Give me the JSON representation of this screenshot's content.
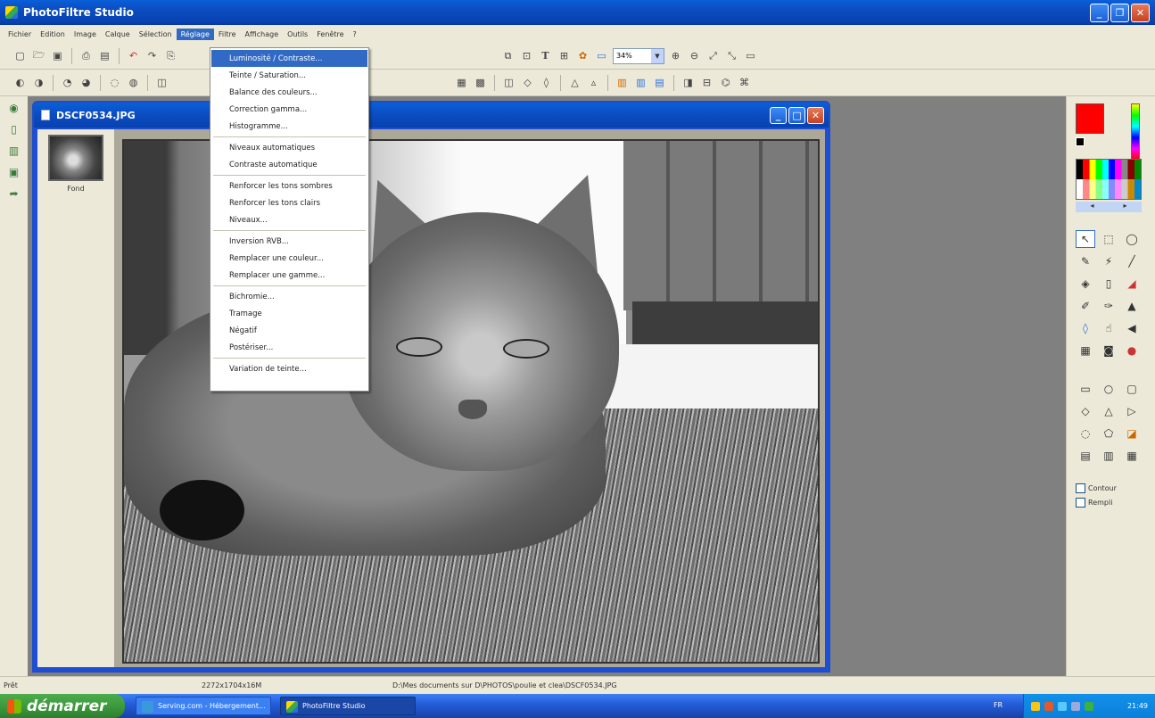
{
  "window": {
    "title": "PhotoFiltre Studio"
  },
  "menubar": {
    "items": [
      "Fichier",
      "Edition",
      "Image",
      "Calque",
      "Sélection",
      "Réglage",
      "Filtre",
      "Affichage",
      "Outils",
      "Fenêtre",
      "?"
    ]
  },
  "toolbar": {
    "zoom_value": "34%"
  },
  "dropdown": {
    "groups": [
      [
        "Luminosité / Contraste...",
        "Teinte / Saturation...",
        "Balance des couleurs...",
        "Correction gamma...",
        "Histogramme..."
      ],
      [
        "Niveaux automatiques",
        "Contraste automatique"
      ],
      [
        "Renforcer les tons sombres",
        "Renforcer les tons clairs",
        "Niveaux..."
      ],
      [
        "Inversion RVB...",
        "Remplacer une couleur...",
        "Remplacer une gamme..."
      ],
      [
        "Bichromie...",
        "Tramage",
        "Négatif",
        "Postériser..."
      ],
      [
        "Variation de teinte..."
      ]
    ]
  },
  "document": {
    "title": "DSCF0534.JPG",
    "layer_name": "Fond"
  },
  "right_panel": {
    "primary_color": "#ff0000",
    "secondary_color": "#000000",
    "contour_label": "Contour",
    "fill_label": "Rempli"
  },
  "statusbar": {
    "state": "Prêt",
    "dimensions": "2272x1704x16M",
    "path": "D:\\Mes documents sur D\\PHOTOS\\poulie et clea\\DSCF0534.JPG"
  },
  "taskbar": {
    "start_label": "démarrer",
    "tasks": [
      "Serving.com - Hébergement...",
      "PhotoFiltre Studio"
    ],
    "language": "FR",
    "clock": "21:49"
  }
}
